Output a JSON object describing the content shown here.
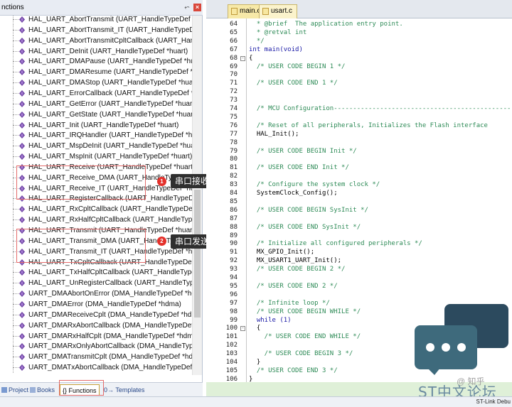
{
  "left_panel": {
    "title": "nctions",
    "functions": [
      "HAL_UART_AbortTransmit (UART_HandleTypeDef *hua",
      "HAL_UART_AbortTransmit_IT (UART_HandleTypeDef *hu",
      "HAL_UART_AbortTransmitCpltCallback (UART_HandleT",
      "HAL_UART_DeInit (UART_HandleTypeDef *huart)",
      "HAL_UART_DMAPause (UART_HandleTypeDef *huart)",
      "HAL_UART_DMAResume (UART_HandleTypeDef *huar",
      "HAL_UART_DMAStop (UART_HandleTypeDef *huart)",
      "HAL_UART_ErrorCallback (UART_HandleTypeDef *hua",
      "HAL_UART_GetError (UART_HandleTypeDef *huart)",
      "HAL_UART_GetState (UART_HandleTypeDef *huart)",
      "HAL_UART_Init (UART_HandleTypeDef *huart)",
      "HAL_UART_IRQHandler (UART_HandleTypeDef *huart)",
      "HAL_UART_MspDeInit (UART_HandleTypeDef *huart)",
      "HAL_UART_MspInit (UART_HandleTypeDef *huart)",
      "HAL_UART_Receive (UART_HandleTypeDef *huart, uin",
      "HAL_UART_Receive_DMA (UART_HandleTypeDef *huart,",
      "HAL_UART_Receive_IT (UART_HandleTypeDef *huart, u",
      "HAL_UART_RegisterCallback (UART_HandleTypeDef *h",
      "HAL_UART_RxCpltCallback (UART_HandleTypeDef *hu",
      "HAL_UART_RxHalfCpltCallback (UART_HandleTypeDef",
      "HAL_UART_Transmit (UART_HandleTypeDef *huart, uin",
      "HAL_UART_Transmit_DMA (UART_HandleTypeDef *huart,",
      "HAL_UART_Transmit_IT (UART_HandleTypeDef *huart,",
      "HAL_UART_TxCpltCallback (UART_HandleTypeDef *hu",
      "HAL_UART_TxHalfCpltCallback (UART_HandleTypeDef",
      "HAL_UART_UnRegisterCallback (UART_HandleTypeDef",
      "UART_DMAAbortOnError (DMA_HandleTypeDef *hdm",
      "UART_DMAError (DMA_HandleTypeDef *hdma)",
      "UART_DMAReceiveCplt (DMA_HandleTypeDef *hdma)",
      "UART_DMARxAbortCallback (DMA_HandleTypeDef *h",
      "UART_DMARxHalfCplt (DMA_HandleTypeDef *hdma)",
      "UART_DMARxOnlyAbortCallback (DMA_HandleTypeD",
      "UART_DMATransmitCplt (DMA_HandleTypeDef *hdma",
      "UART_DMATxAbortCallback (DMA_HandleTypeDef *h"
    ],
    "tabs": [
      "Project",
      "Books",
      "{} Functions",
      "0→ Templates"
    ]
  },
  "callouts": {
    "receive": {
      "number": "1",
      "label": "串口接收"
    },
    "transmit": {
      "number": "2",
      "label": "串口发送"
    }
  },
  "editor": {
    "tabs": [
      "main.c",
      "usart.c"
    ],
    "lines": [
      {
        "n": "64",
        "text": "  * @brief  The application entry point.",
        "cls": "c-comment"
      },
      {
        "n": "65",
        "text": "  * @retval int",
        "cls": "c-comment"
      },
      {
        "n": "66",
        "text": "  */",
        "cls": "c-comment"
      },
      {
        "n": "67",
        "text": "int main(void)",
        "cls": "c-kw"
      },
      {
        "n": "68",
        "text": "{",
        "cls": "",
        "fold": "-"
      },
      {
        "n": "69",
        "text": "  /* USER CODE BEGIN 1 */",
        "cls": "c-comment"
      },
      {
        "n": "70",
        "text": "",
        "cls": ""
      },
      {
        "n": "71",
        "text": "  /* USER CODE END 1 */",
        "cls": "c-comment"
      },
      {
        "n": "72",
        "text": "",
        "cls": ""
      },
      {
        "n": "73",
        "text": "",
        "cls": ""
      },
      {
        "n": "74",
        "text": "  /* MCU Configuration--------------------------------------------------------",
        "cls": "c-comment"
      },
      {
        "n": "75",
        "text": "",
        "cls": ""
      },
      {
        "n": "76",
        "text": "  /* Reset of all peripherals, Initializes the Flash interface",
        "cls": "c-comment"
      },
      {
        "n": "77",
        "text": "  HAL_Init();",
        "cls": ""
      },
      {
        "n": "78",
        "text": "",
        "cls": ""
      },
      {
        "n": "79",
        "text": "  /* USER CODE BEGIN Init */",
        "cls": "c-comment"
      },
      {
        "n": "80",
        "text": "",
        "cls": ""
      },
      {
        "n": "81",
        "text": "  /* USER CODE END Init */",
        "cls": "c-comment"
      },
      {
        "n": "82",
        "text": "",
        "cls": ""
      },
      {
        "n": "83",
        "text": "  /* Configure the system clock */",
        "cls": "c-comment"
      },
      {
        "n": "84",
        "text": "  SystemClock_Config();",
        "cls": ""
      },
      {
        "n": "85",
        "text": "",
        "cls": ""
      },
      {
        "n": "86",
        "text": "  /* USER CODE BEGIN SysInit */",
        "cls": "c-comment"
      },
      {
        "n": "87",
        "text": "",
        "cls": ""
      },
      {
        "n": "88",
        "text": "  /* USER CODE END SysInit */",
        "cls": "c-comment"
      },
      {
        "n": "89",
        "text": "",
        "cls": ""
      },
      {
        "n": "90",
        "text": "  /* Initialize all configured peripherals */",
        "cls": "c-comment"
      },
      {
        "n": "91",
        "text": "  MX_GPIO_Init();",
        "cls": ""
      },
      {
        "n": "92",
        "text": "  MX_USART1_UART_Init();",
        "cls": ""
      },
      {
        "n": "93",
        "text": "  /* USER CODE BEGIN 2 */",
        "cls": "c-comment"
      },
      {
        "n": "94",
        "text": "",
        "cls": ""
      },
      {
        "n": "95",
        "text": "  /* USER CODE END 2 */",
        "cls": "c-comment"
      },
      {
        "n": "96",
        "text": "",
        "cls": ""
      },
      {
        "n": "97",
        "text": "  /* Infinite loop */",
        "cls": "c-comment"
      },
      {
        "n": "98",
        "text": "  /* USER CODE BEGIN WHILE */",
        "cls": "c-comment"
      },
      {
        "n": "99",
        "text": "  while (1)",
        "cls": "c-kw"
      },
      {
        "n": "100",
        "text": "  {",
        "cls": "",
        "fold": "-"
      },
      {
        "n": "101",
        "text": "    /* USER CODE END WHILE */",
        "cls": "c-comment"
      },
      {
        "n": "102",
        "text": "",
        "cls": ""
      },
      {
        "n": "103",
        "text": "    /* USER CODE BEGIN 3 */",
        "cls": "c-comment"
      },
      {
        "n": "104",
        "text": "  }",
        "cls": ""
      },
      {
        "n": "105",
        "text": "  /* USER CODE END 3 */",
        "cls": "c-comment"
      },
      {
        "n": "106",
        "text": "}",
        "cls": ""
      }
    ]
  },
  "status_bar": {
    "text": "ST-Link Debu"
  },
  "watermark": {
    "text": "ST中文论坛",
    "sub": "@ 知乎"
  },
  "colors": {
    "highlight_box": "#e36b6b",
    "callout_bg": "#2f2f2f",
    "callout_dot": "#e4312b",
    "comment": "#2e8b57",
    "keyword": "#1a1aa6"
  }
}
